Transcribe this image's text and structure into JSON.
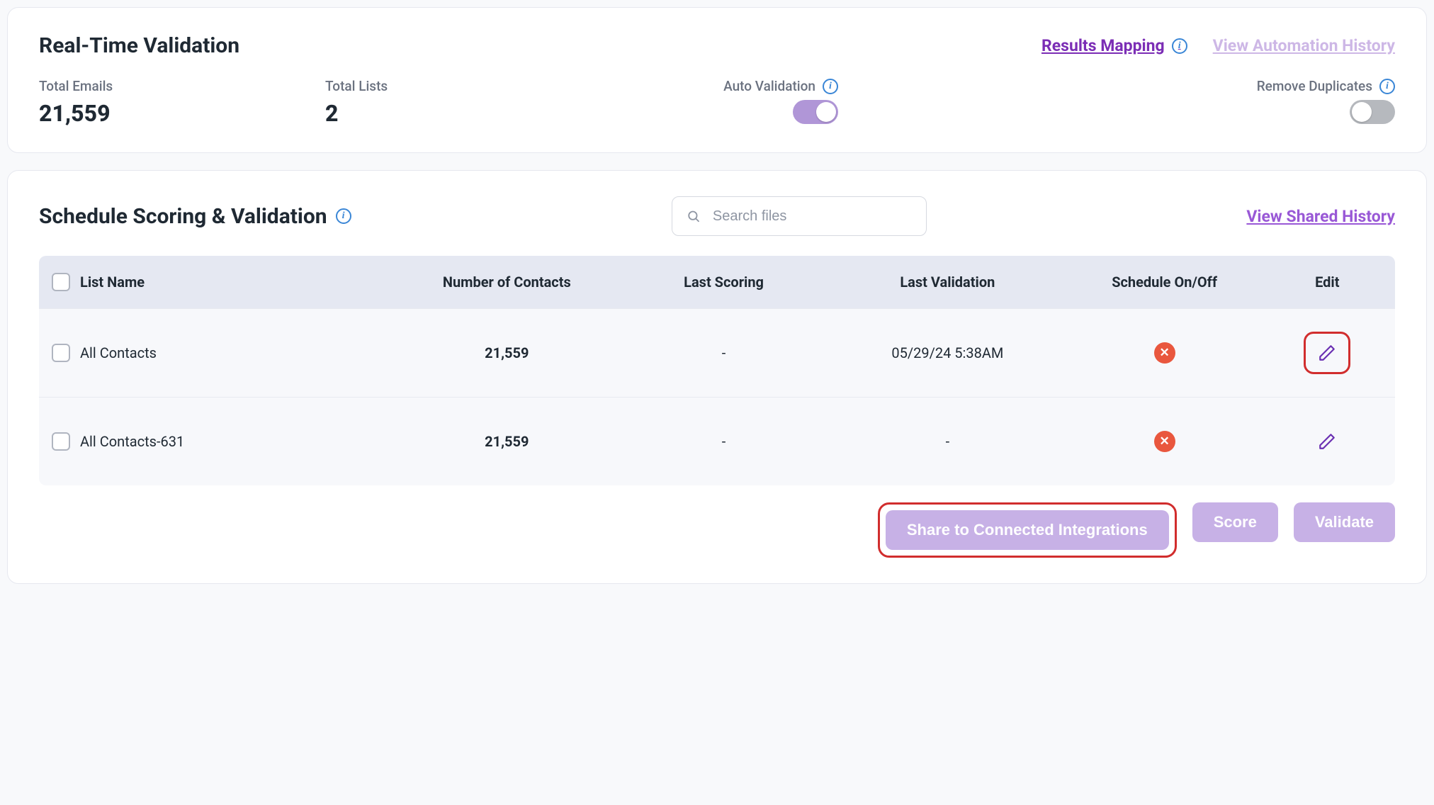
{
  "top": {
    "title": "Real-Time Validation",
    "links": {
      "results_mapping": "Results Mapping",
      "automation_history": "View Automation History"
    },
    "stats": {
      "total_emails_label": "Total Emails",
      "total_emails_value": "21,559",
      "total_lists_label": "Total Lists",
      "total_lists_value": "2",
      "auto_validation_label": "Auto Validation",
      "remove_duplicates_label": "Remove Duplicates"
    }
  },
  "schedule": {
    "title": "Schedule Scoring & Validation",
    "search_placeholder": "Search files",
    "view_shared_history": "View Shared History",
    "columns": {
      "list_name": "List Name",
      "num_contacts": "Number of Contacts",
      "last_scoring": "Last Scoring",
      "last_validation": "Last Validation",
      "schedule_on_off": "Schedule On/Off",
      "edit": "Edit"
    },
    "rows": [
      {
        "name": "All Contacts",
        "contacts": "21,559",
        "last_scoring": "-",
        "last_validation": "05/29/24 5:38AM"
      },
      {
        "name": "All Contacts-631",
        "contacts": "21,559",
        "last_scoring": "-",
        "last_validation": "-"
      }
    ],
    "actions": {
      "share": "Share to Connected Integrations",
      "score": "Score",
      "validate": "Validate"
    }
  }
}
